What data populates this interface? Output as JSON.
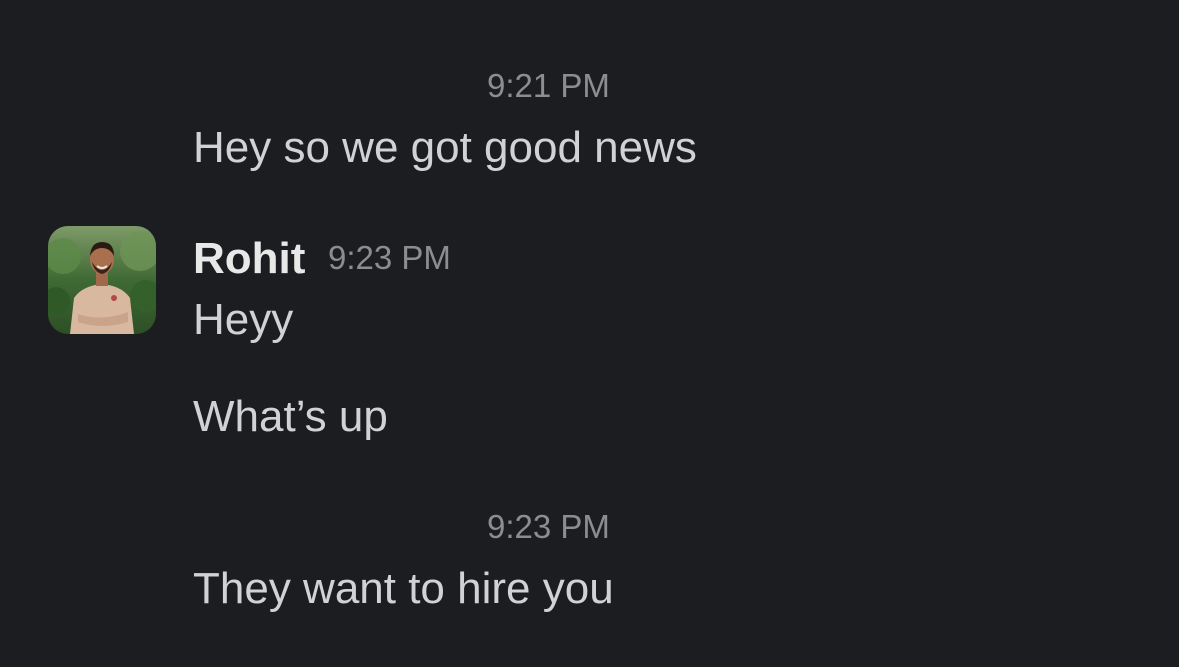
{
  "messages": [
    {
      "timestamp": "9:21 PM",
      "text": "Hey so we got good news"
    },
    {
      "sender": "Rohit",
      "timestamp": "9:23 PM",
      "lines": [
        "Heyy",
        "What’s up"
      ]
    },
    {
      "timestamp": "9:23 PM",
      "text": "They want to hire you"
    }
  ],
  "colors": {
    "background": "#1b1d21",
    "text": "#d1d2d3",
    "timestamp": "#8b8d90"
  },
  "icons": {
    "avatar": "user-photo-avatar"
  }
}
